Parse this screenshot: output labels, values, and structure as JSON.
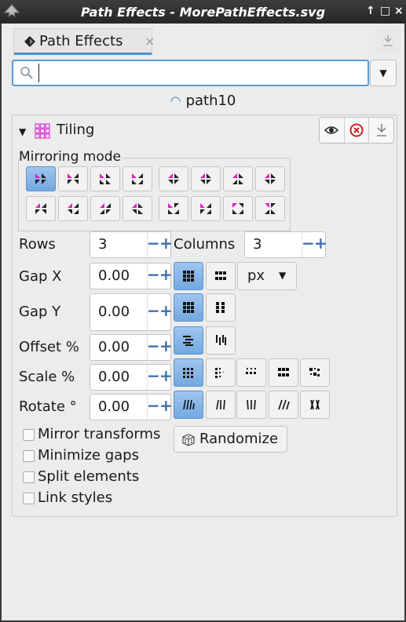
{
  "window": {
    "title": "Path Effects - MorePathEffects.svg",
    "controls": [
      "↑",
      "□",
      "×"
    ]
  },
  "tab": {
    "label": "Path Effects",
    "close": "×"
  },
  "search": {
    "value": "",
    "placeholder": ""
  },
  "target": {
    "name": "path10"
  },
  "effect": {
    "name": "Tiling",
    "mirroring_title": "Mirroring mode",
    "mirroring_selected_index": 0,
    "fields": {
      "rows": {
        "label": "Rows",
        "value": "3"
      },
      "columns": {
        "label": "Columns",
        "value": "3"
      },
      "gap_x": {
        "label": "Gap X",
        "value": "0.00"
      },
      "gap_y": {
        "label": "Gap Y",
        "value": "0.00"
      },
      "offset": {
        "label": "Offset %",
        "value": "0.00"
      },
      "scale": {
        "label": "Scale %",
        "value": "0.00"
      },
      "rotate": {
        "label": "Rotate °",
        "value": "0.00"
      }
    },
    "unit": "px",
    "checkboxes": [
      {
        "label": "Mirror transforms",
        "checked": false
      },
      {
        "label": "Minimize gaps",
        "checked": false
      },
      {
        "label": "Split elements",
        "checked": false
      },
      {
        "label": "Link styles",
        "checked": false
      }
    ],
    "randomize_label": "Randomize"
  },
  "colors": {
    "accent": "#4a8ed8",
    "magenta": "#e020c8",
    "active_fill": "#85b5e6"
  }
}
